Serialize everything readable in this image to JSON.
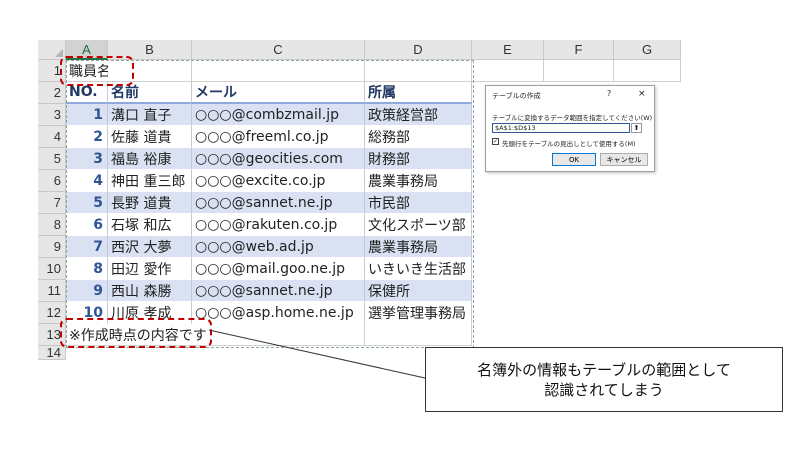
{
  "columns": [
    "A",
    "B",
    "C",
    "D",
    "E",
    "F",
    "G"
  ],
  "rows": [
    "1",
    "2",
    "3",
    "4",
    "5",
    "6",
    "7",
    "8",
    "9",
    "10",
    "11",
    "12",
    "13",
    "14"
  ],
  "title_cell": "職員名簿",
  "headers": [
    "NO.",
    "名前",
    "メール",
    "所属"
  ],
  "records": [
    {
      "no": "1",
      "name": "溝口 直子",
      "mail": "○○○@combzmail.jp",
      "dept": "政策経営部"
    },
    {
      "no": "2",
      "name": "佐藤 道貴",
      "mail": "○○○@freeml.co.jp",
      "dept": "総務部"
    },
    {
      "no": "3",
      "name": "福島 裕康",
      "mail": "○○○@geocities.com",
      "dept": "財務部"
    },
    {
      "no": "4",
      "name": "神田 重三郎",
      "mail": "○○○@excite.co.jp",
      "dept": "農業事務局"
    },
    {
      "no": "5",
      "name": "長野 道貴",
      "mail": "○○○@sannet.ne.jp",
      "dept": "市民部"
    },
    {
      "no": "6",
      "name": "石塚 和広",
      "mail": "○○○@rakuten.co.jp",
      "dept": "文化スポーツ部"
    },
    {
      "no": "7",
      "name": "西沢 大夢",
      "mail": "○○○@web.ad.jp",
      "dept": "農業事務局"
    },
    {
      "no": "8",
      "name": "田辺 愛作",
      "mail": "○○○@mail.goo.ne.jp",
      "dept": "いきいき生活部"
    },
    {
      "no": "9",
      "name": "西山 森勝",
      "mail": "○○○@sannet.ne.jp",
      "dept": "保健所"
    },
    {
      "no": "10",
      "name": "川原 孝成",
      "mail": "○○○@asp.home.ne.jp",
      "dept": "選挙管理事務局"
    }
  ],
  "note_cell": "※作成時点の内容です",
  "dialog": {
    "title": "テーブルの作成",
    "help": "?",
    "close": "×",
    "range_label": "テーブルに変換するデータ範囲を指定してください(W)",
    "range_value": "$A$1:$D$13",
    "checkbox_checked": true,
    "checkbox_label": "先頭行をテーブルの見出しとして使用する(M)",
    "ok": "OK",
    "cancel": "キャンセル"
  },
  "callout": {
    "line1": "名簿外の情報もテーブルの範囲として",
    "line2": "認識されてしまう"
  },
  "colors": {
    "band": "#d9e1f2",
    "header_text": "#1f3864",
    "number_text": "#2f5597",
    "highlight": "#c00000"
  }
}
